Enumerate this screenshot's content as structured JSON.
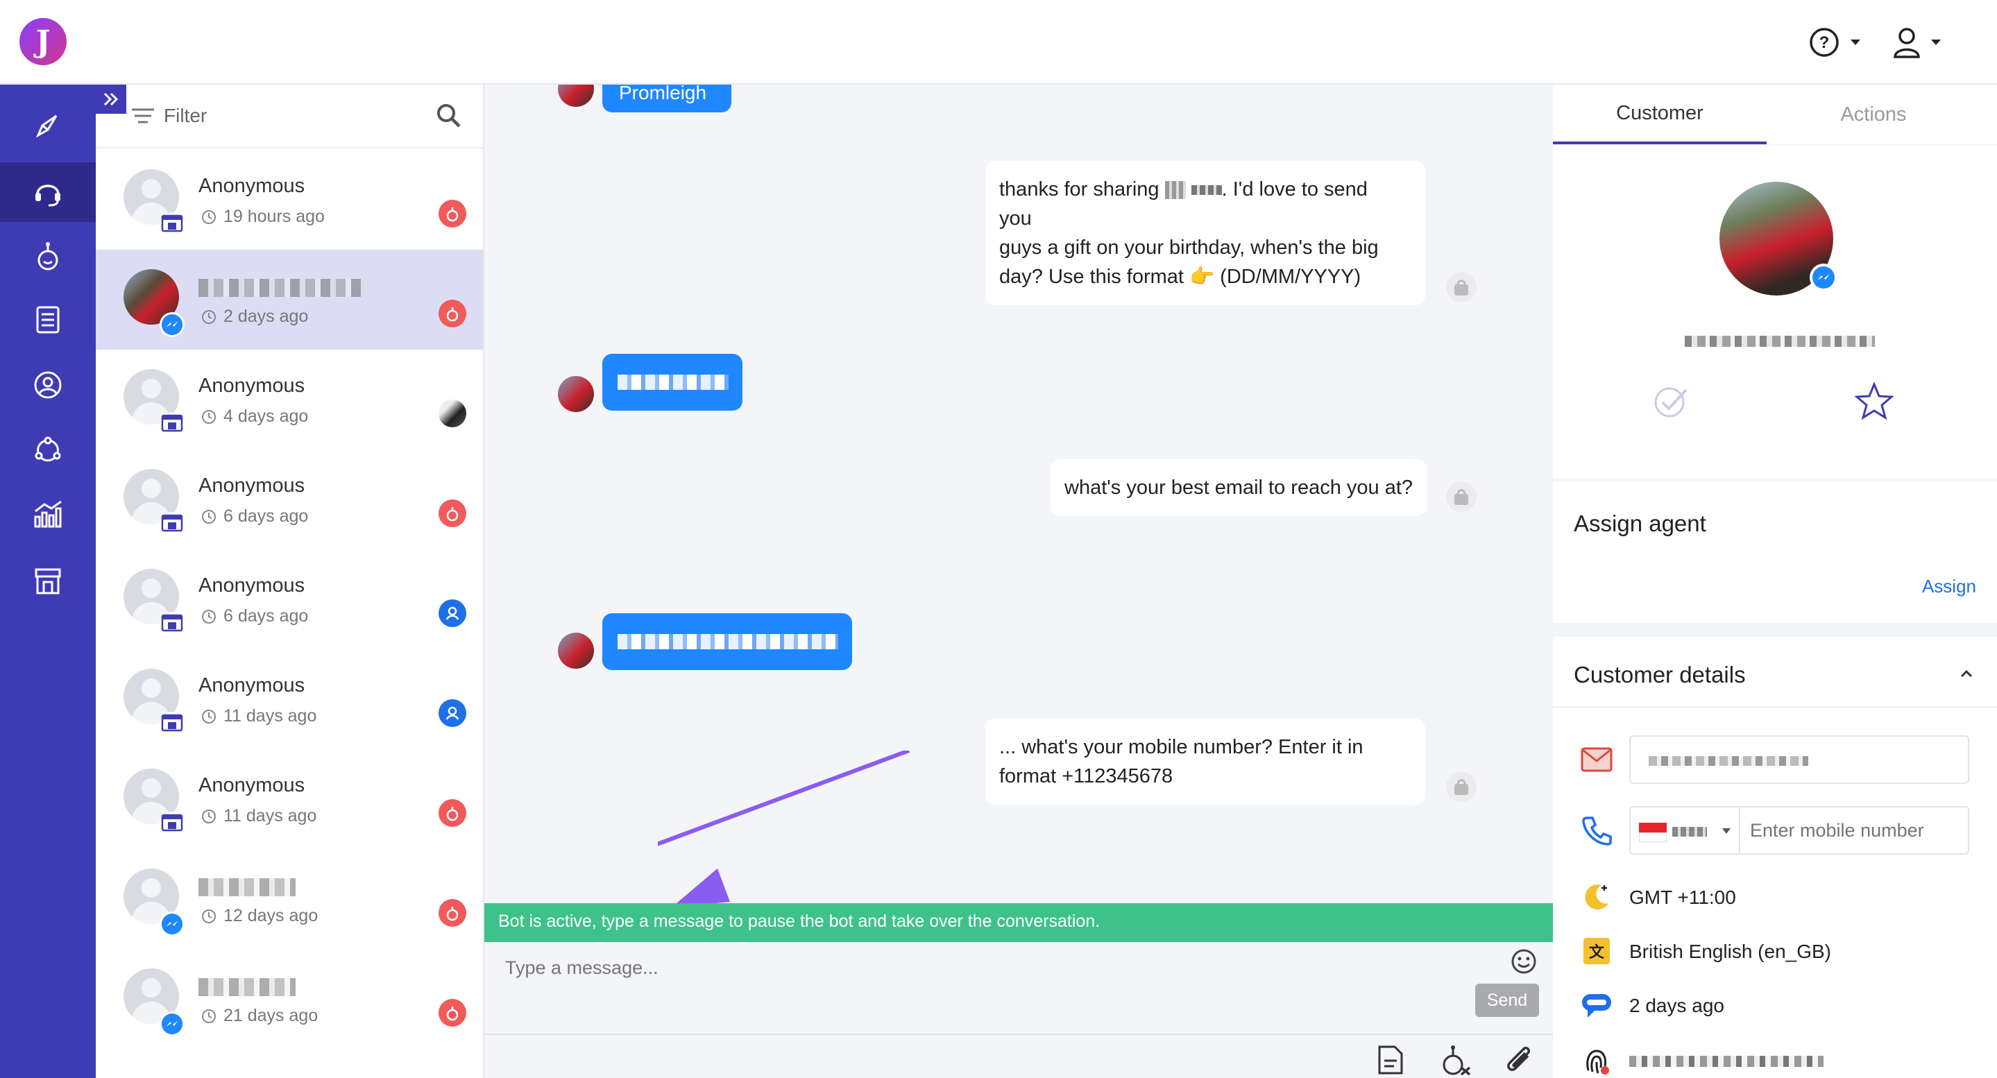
{
  "app": {
    "logo_letter": "J"
  },
  "topbar": {
    "help_icon": "help-circle-icon",
    "user_icon": "user-icon"
  },
  "sidebar": {
    "items": [
      {
        "icon": "rocket-icon"
      },
      {
        "icon": "headset-icon",
        "active": true
      },
      {
        "icon": "bot-icon"
      },
      {
        "icon": "clipboard-list-icon"
      },
      {
        "icon": "user-circle-icon"
      },
      {
        "icon": "segments-icon"
      },
      {
        "icon": "analytics-icon"
      },
      {
        "icon": "store-icon"
      }
    ]
  },
  "conversation_list": {
    "filter_label": "Filter",
    "items": [
      {
        "name": "Anonymous",
        "time": "19 hours ago",
        "channel": "web",
        "status": "bot"
      },
      {
        "name": "",
        "time": "2 days ago",
        "channel": "messenger",
        "status": "bot",
        "selected": true
      },
      {
        "name": "Anonymous",
        "time": "4 days ago",
        "channel": "web",
        "status": "agent-photo"
      },
      {
        "name": "Anonymous",
        "time": "6 days ago",
        "channel": "web",
        "status": "bot"
      },
      {
        "name": "Anonymous",
        "time": "6 days ago",
        "channel": "web",
        "status": "agent"
      },
      {
        "name": "Anonymous",
        "time": "11 days ago",
        "channel": "web",
        "status": "agent"
      },
      {
        "name": "Anonymous",
        "time": "11 days ago",
        "channel": "web",
        "status": "bot"
      },
      {
        "name": "",
        "time": "12 days ago",
        "channel": "messenger",
        "status": "bot"
      },
      {
        "name": "",
        "time": "21 days ago",
        "channel": "messenger",
        "status": "bot"
      }
    ]
  },
  "chat": {
    "partial_top_message": "Promleigh",
    "messages": [
      {
        "from": "bot",
        "text_line1": "thanks for sharing",
        "text_line1_tail": ". I'd love to send",
        "text_line2": "you",
        "text_line3": "guys a gift on your birthday, when's the big",
        "text_line4": "day? Use this format 👉 (DD/MM/YYYY)"
      },
      {
        "from": "customer",
        "redacted": true
      },
      {
        "from": "bot",
        "text": "what's your best email to reach you at?"
      },
      {
        "from": "customer",
        "redacted": true
      },
      {
        "from": "bot",
        "text_line1": "... what's your mobile number? Enter it in",
        "text_line2": "format +112345678"
      }
    ],
    "bot_banner": "Bot is active, type a message to pause the bot and take over the conversation.",
    "composer_placeholder": "Type a message...",
    "send_label": "Send"
  },
  "right_panel": {
    "tabs": [
      {
        "label": "Customer",
        "active": true
      },
      {
        "label": "Actions",
        "active": false
      }
    ],
    "assign_title": "Assign agent",
    "assign_link": "Assign",
    "details_title": "Customer details",
    "mobile_placeholder": "Enter mobile number",
    "timezone": "GMT +11:00",
    "language": "British English (en_GB)",
    "last_seen": "2 days ago"
  },
  "colors": {
    "sidebar": "#3f3bb5",
    "accent_blue": "#1f87ff",
    "bot_banner": "#3ec28a",
    "status_bot": "#f05a5a",
    "status_agent": "#1f6fe8"
  }
}
